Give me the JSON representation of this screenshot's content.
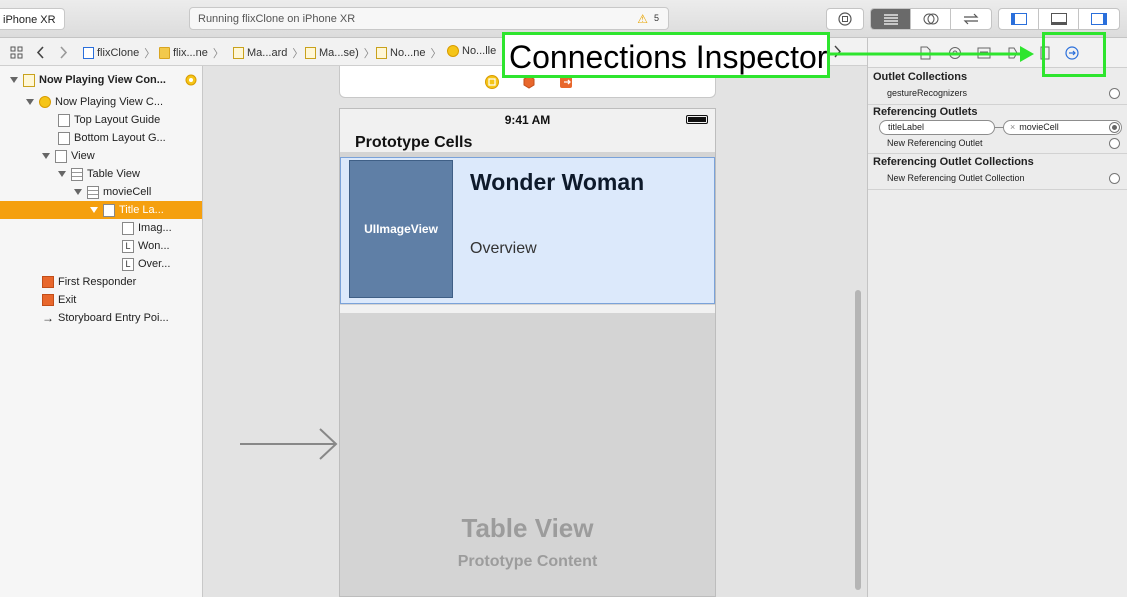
{
  "toolbar": {
    "scheme_device": "iPhone XR",
    "activity_text": "Running flixClone on iPhone XR",
    "warning_count": "5"
  },
  "jumpbar": {
    "crumbs": [
      "flixClone",
      "flix...ne",
      "Ma...ard",
      "Ma...se)",
      "No...ne",
      "No...lle"
    ]
  },
  "outline": {
    "items": [
      {
        "label": "Now Playing View Con...",
        "bold": true
      },
      {
        "label": "Now Playing View C..."
      },
      {
        "label": "Top Layout Guide"
      },
      {
        "label": "Bottom Layout G..."
      },
      {
        "label": "View"
      },
      {
        "label": "Table View"
      },
      {
        "label": "movieCell"
      },
      {
        "label": "Title La..."
      },
      {
        "label": "Imag..."
      },
      {
        "label": "Won..."
      },
      {
        "label": "Over..."
      },
      {
        "label": "First Responder"
      },
      {
        "label": "Exit"
      },
      {
        "label": "Storyboard Entry Poi..."
      }
    ]
  },
  "canvas": {
    "status_time": "9:41 AM",
    "prototype_header": "Prototype Cells",
    "image_view_label": "UIImageView",
    "cell_title": "Wonder Woman",
    "cell_overview": "Overview",
    "table_view_title": "Table View",
    "table_view_subtitle": "Prototype Content"
  },
  "inspector": {
    "outlet_collections": "Outlet Collections",
    "gesture_recognizers": "gestureRecognizers",
    "referencing_outlets": "Referencing Outlets",
    "outlet_source": "titleLabel",
    "outlet_target": "movieCell",
    "new_referencing_outlet": "New Referencing Outlet",
    "referencing_outlet_collections": "Referencing Outlet Collections",
    "new_referencing_outlet_collection": "New Referencing Outlet Collection"
  },
  "annotation": {
    "label": "Connections Inspector",
    "color": "#2ee52e"
  },
  "colors": {
    "selection": "#f5a00f",
    "accent": "#2a6fdb",
    "cell_bg": "#dce9fb",
    "image_view": "#5f7fa6"
  }
}
